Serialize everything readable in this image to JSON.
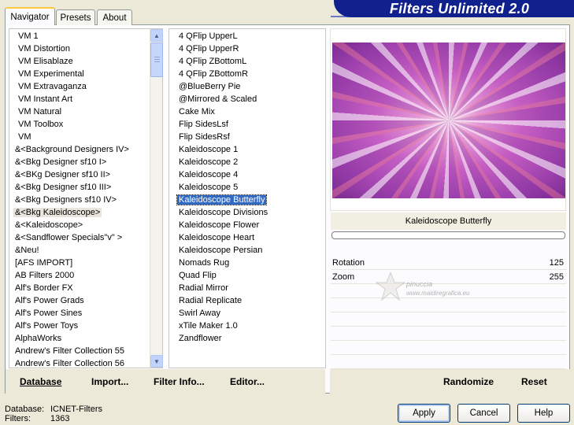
{
  "banner": {
    "title": "Filters Unlimited 2.0"
  },
  "tabs": [
    {
      "label": "Navigator"
    },
    {
      "label": "Presets"
    },
    {
      "label": "About"
    }
  ],
  "categories": [
    "VM 1",
    "VM Distortion",
    "VM Elisablaze",
    "VM Experimental",
    "VM Extravaganza",
    "VM Instant Art",
    "VM Natural",
    "VM Toolbox",
    "VM",
    "&<Background Designers IV>",
    "&<Bkg Designer sf10 I>",
    "&<BKg Designer sf10 II>",
    "&<Bkg Designer sf10 III>",
    "&<Bkg Designers sf10 IV>",
    "&<Bkg Kaleidoscope>",
    "&<Kaleidoscope>",
    "&<Sandflower Specials\"v\" >",
    "&Neu!",
    "[AFS IMPORT]",
    "AB Filters 2000",
    "Alf's Border FX",
    "Alf's Power Grads",
    "Alf's Power Sines",
    "Alf's Power Toys",
    "AlphaWorks",
    "Andrew's Filter Collection 55",
    "Andrew's Filter Collection 56"
  ],
  "selected_category": "&<Bkg Kaleidoscope>",
  "filters": [
    "4 QFlip UpperL",
    "4 QFlip UpperR",
    "4 QFlip ZBottomL",
    "4 QFlip ZBottomR",
    "@BlueBerry Pie",
    "@Mirrored & Scaled",
    "Cake Mix",
    "Flip SidesLsf",
    "Flip SidesRsf",
    "Kaleidoscope 1",
    "Kaleidoscope 2",
    "Kaleidoscope 4",
    "Kaleidoscope 5",
    "Kaleidoscope Butterfly",
    "Kaleidoscope Divisions",
    "Kaleidoscope Flower",
    "Kaleidoscope Heart",
    "Kaleidoscope Persian",
    "Nomads Rug",
    "Quad Flip",
    "Radial Mirror",
    "Radial Replicate",
    "Swirl Away",
    "xTile Maker 1.0",
    "Zandflower"
  ],
  "selected_filter": "Kaleidoscope Butterfly",
  "preview": {
    "filter_name": "Kaleidoscope Butterfly"
  },
  "params": [
    {
      "label": "Rotation",
      "value": "125"
    },
    {
      "label": "Zoom",
      "value": "255"
    }
  ],
  "watermark": {
    "line1": "pinuccia",
    "line2": "www.maidiregrafica.eu"
  },
  "bottom_bar": {
    "database": "Database",
    "import": "Import...",
    "filter_info": "Filter Info...",
    "editor": "Editor...",
    "randomize": "Randomize",
    "reset": "Reset"
  },
  "status": {
    "database_label": "Database:",
    "database_value": "ICNET-Filters",
    "filters_label": "Filters:",
    "filters_value": "1363"
  },
  "buttons": {
    "apply": "Apply",
    "cancel": "Cancel",
    "help": "Help"
  },
  "colors": {
    "banner": "#10208c",
    "selection": "#316ac5",
    "tab_highlight": "#ffc83c"
  }
}
